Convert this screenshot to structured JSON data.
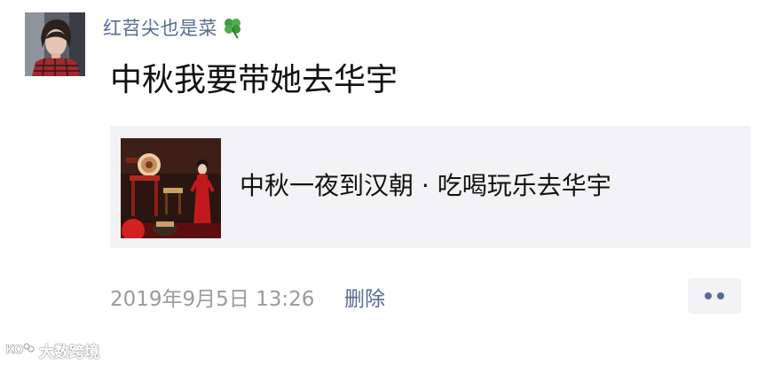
{
  "post": {
    "username": "红苕尖也是菜",
    "username_emoji": "four-leaf-clover-icon",
    "text": "中秋我要带她去华宇",
    "link_card": {
      "title": "中秋一夜到汉朝 · 吃喝玩乐去华宇"
    },
    "timestamp": "2019年9月5日 13:26",
    "delete_label": "删除",
    "more_icon": "more-dots-icon"
  },
  "watermark": {
    "text": "大数跨境"
  },
  "colors": {
    "name_link": "#576b95",
    "meta_text": "#9a9a9a",
    "card_bg": "#f3f3f5"
  }
}
